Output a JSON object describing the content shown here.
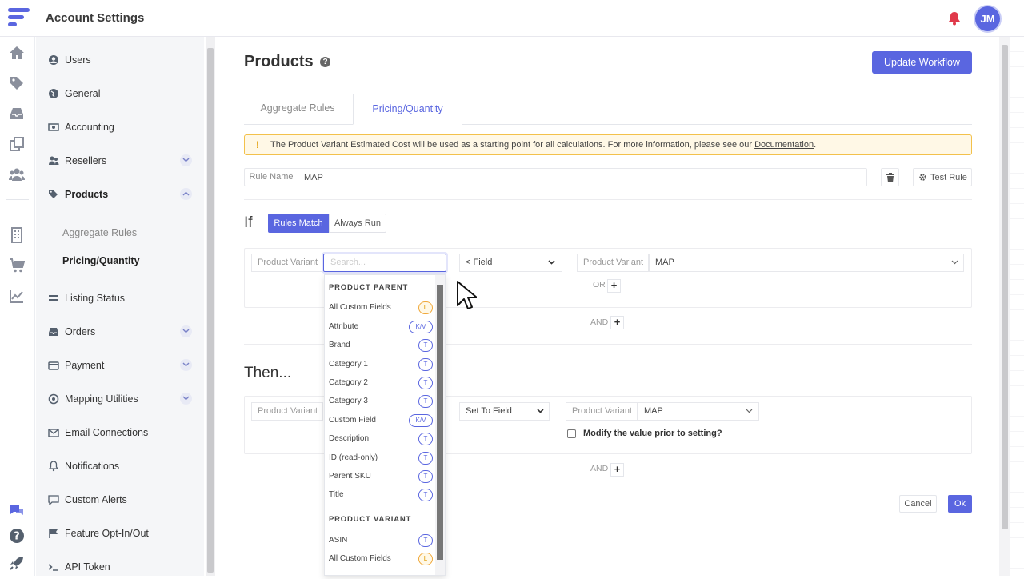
{
  "header": {
    "title": "Account Settings",
    "avatar_initials": "JM",
    "brand_color": "#5a66e0"
  },
  "rail_icons": [
    "home-icon",
    "tag-icon",
    "inbox-icon",
    "copy-icon",
    "users-icon",
    "building-icon",
    "cart-icon",
    "chart-line-icon",
    "chat-icon",
    "question-icon",
    "rocket-icon"
  ],
  "nav": {
    "items": [
      {
        "label": "Users",
        "icon": "user-circle-icon"
      },
      {
        "label": "General",
        "icon": "globe-icon"
      },
      {
        "label": "Accounting",
        "icon": "money-icon"
      },
      {
        "label": "Resellers",
        "icon": "users-icon"
      },
      {
        "label": "Products",
        "icon": "tags-icon"
      },
      {
        "label": "Listing Status",
        "icon": "list-icon"
      },
      {
        "label": "Orders",
        "icon": "inbox-icon"
      },
      {
        "label": "Payment",
        "icon": "credit-card-icon"
      },
      {
        "label": "Mapping Utilities",
        "icon": "target-icon"
      },
      {
        "label": "Email Connections",
        "icon": "envelope-icon"
      },
      {
        "label": "Notifications",
        "icon": "bell-icon"
      },
      {
        "label": "Custom Alerts",
        "icon": "comment-icon"
      },
      {
        "label": "Feature Opt-In/Out",
        "icon": "flag-icon"
      },
      {
        "label": "API Token",
        "icon": "terminal-icon"
      }
    ],
    "sub_items": [
      "Aggregate Rules",
      "Pricing/Quantity"
    ]
  },
  "main": {
    "title": "Products",
    "update_button": "Update Workflow",
    "tabs": [
      "Aggregate Rules",
      "Pricing/Quantity"
    ],
    "alert": {
      "text": "The Product Variant Estimated Cost will be used as a starting point for all calculations. For more information, please see our",
      "link": "Documentation",
      "tail": "."
    },
    "rule_name_label": "Rule Name",
    "rule_name_value": "MAP",
    "test_rule": "Test Rule",
    "if_label": "If",
    "match_modes": [
      "Rules Match",
      "Always Run"
    ],
    "condition": {
      "left_label": "Product Variant",
      "search_placeholder": "Search...",
      "operator": "< Field",
      "right_label": "Product Variant",
      "right_value": "MAP",
      "or": "OR",
      "and": "AND"
    },
    "then_label": "Then...",
    "action": {
      "left_label": "Product Variant",
      "operator": "Set To Field",
      "right_label": "Product Variant",
      "right_value": "MAP",
      "modify_label": "Modify the value prior to setting?",
      "and": "AND"
    },
    "cancel": "Cancel",
    "ok": "Ok"
  },
  "dropdown": {
    "groups": [
      {
        "title": "PRODUCT PARENT",
        "options": [
          {
            "label": "All Custom Fields",
            "badge": "L"
          },
          {
            "label": "Attribute",
            "badge": "K/V"
          },
          {
            "label": "Brand",
            "badge": "T"
          },
          {
            "label": "Category 1",
            "badge": "T"
          },
          {
            "label": "Category 2",
            "badge": "T"
          },
          {
            "label": "Category 3",
            "badge": "T"
          },
          {
            "label": "Custom Field",
            "badge": "K/V"
          },
          {
            "label": "Description",
            "badge": "T"
          },
          {
            "label": "ID (read-only)",
            "badge": "T"
          },
          {
            "label": "Parent SKU",
            "badge": "T"
          },
          {
            "label": "Title",
            "badge": "T"
          }
        ]
      },
      {
        "title": "PRODUCT VARIANT",
        "options": [
          {
            "label": "ASIN",
            "badge": "T"
          },
          {
            "label": "All Custom Fields",
            "badge": "L"
          }
        ]
      }
    ]
  }
}
